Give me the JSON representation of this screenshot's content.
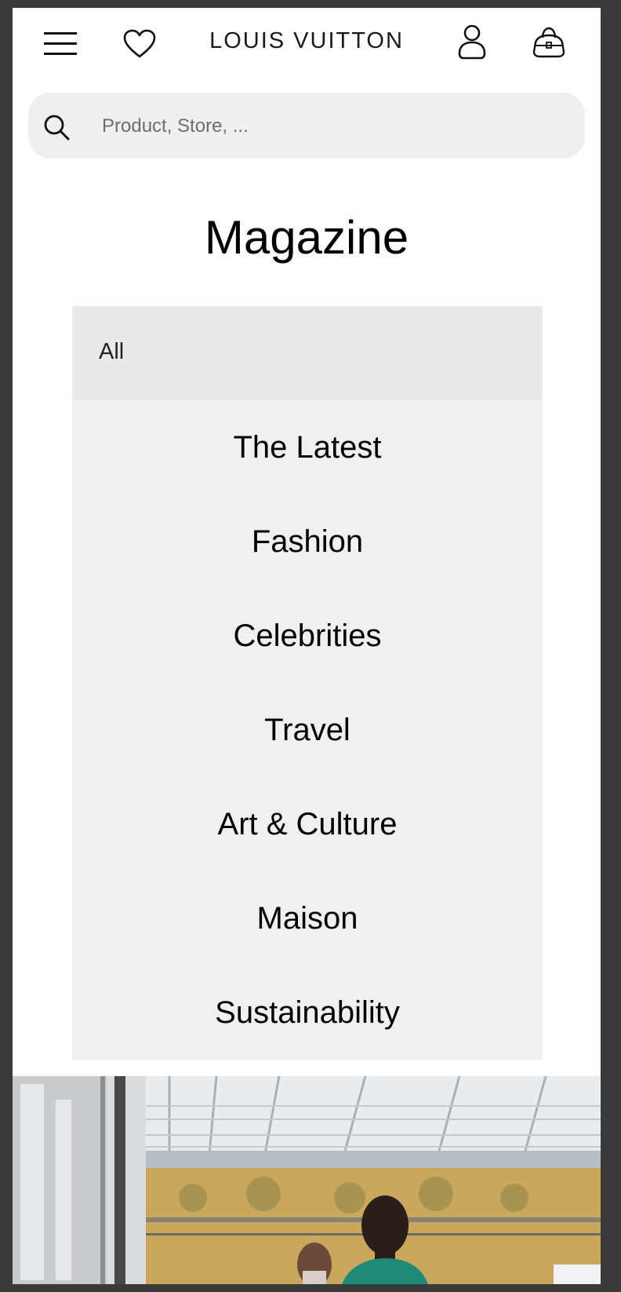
{
  "header": {
    "brand": "LOUIS VUITTON",
    "icons": {
      "menu": "hamburger-menu-icon",
      "wishlist": "heart-icon",
      "account": "user-icon",
      "bag": "shopping-bag-icon"
    }
  },
  "search": {
    "placeholder": "Product, Store, ..."
  },
  "page": {
    "title": "Magazine"
  },
  "category_menu": {
    "selected": "All",
    "items": [
      "The Latest",
      "Fashion",
      "Celebrities",
      "Travel",
      "Art & Culture",
      "Maison",
      "Sustainability"
    ]
  },
  "colors": {
    "panel_background": "#f0f0f0",
    "search_background": "#efefef",
    "text": "#000000"
  }
}
